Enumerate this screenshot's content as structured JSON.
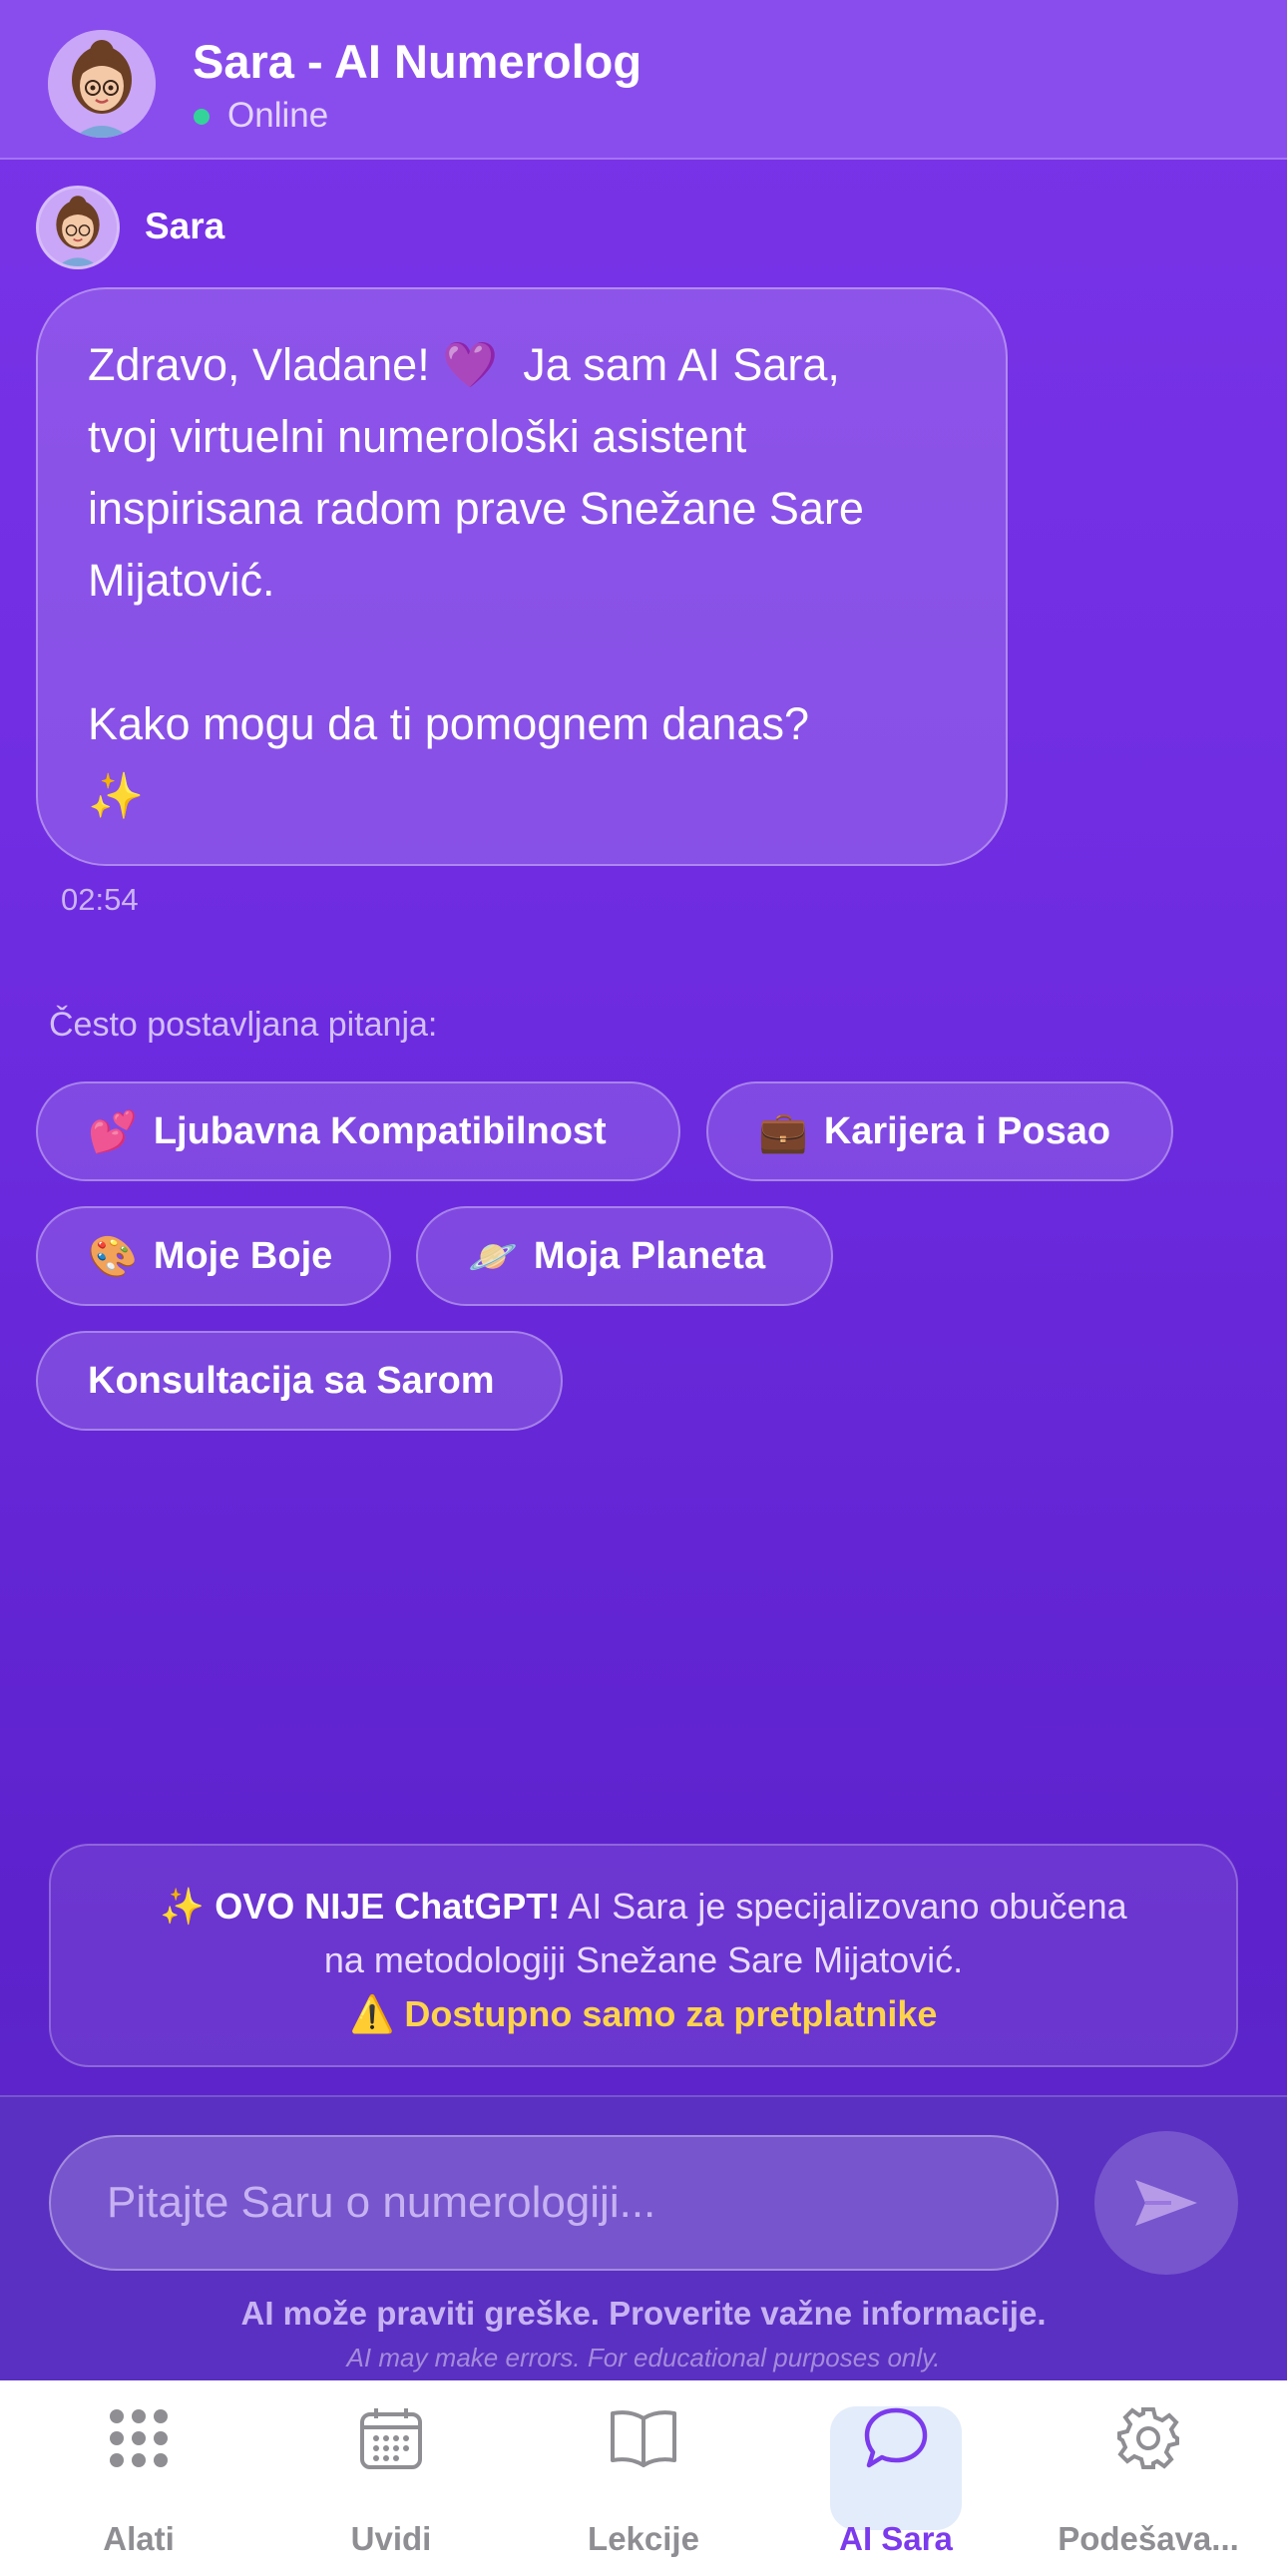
{
  "header": {
    "title": "Sara - AI Numerolog",
    "status": "Online",
    "avatar": "sara-avatar"
  },
  "message": {
    "sender": "Sara",
    "text": "Zdravo, Vladane! 💜  Ja sam AI Sara,\ntvoj virtuelni numerološki asistent\ninspirisana radom prave Snežane Sare\nMijatović.\n\nKako mogu da ti pomognem danas?\n✨",
    "time": "02:54"
  },
  "faq": {
    "label": "Često postavljana pitanja:",
    "chips": [
      {
        "emoji": "💕",
        "label": "Ljubavna Kompatibilnost"
      },
      {
        "emoji": "💼",
        "label": "Karijera i Posao"
      },
      {
        "emoji": "🎨",
        "label": "Moje Boje"
      },
      {
        "emoji": "🪐",
        "label": "Moja Planeta"
      },
      {
        "emoji": "",
        "label": "Konsultacija sa Sarom"
      }
    ]
  },
  "notice": {
    "sparkle": "✨",
    "bold": "OVO NIJE ChatGPT!",
    "text1": " AI Sara je specijalizovano obučena",
    "text2": "na metodologiji Snežane Sare Mijatović.",
    "warning": "⚠️ Dostupno samo za pretplatnike"
  },
  "input": {
    "placeholder": "Pitajte Saru o numerologiji...",
    "disclaimer": "AI može praviti greške. Proverite važne informacije.",
    "disclaimer_en": "AI may make errors. For educational purposes only."
  },
  "tabs": [
    {
      "label": "Alati",
      "icon": "grid-icon",
      "active": false
    },
    {
      "label": "Uvidi",
      "icon": "calendar-icon",
      "active": false
    },
    {
      "label": "Lekcije",
      "icon": "book-icon",
      "active": false
    },
    {
      "label": "AI Sara",
      "icon": "chat-icon",
      "active": true
    },
    {
      "label": "Podešava...",
      "icon": "gear-icon",
      "active": false
    }
  ],
  "colors": {
    "accent": "#7c3aed",
    "online": "#34d399",
    "warning": "#fcd34d"
  }
}
